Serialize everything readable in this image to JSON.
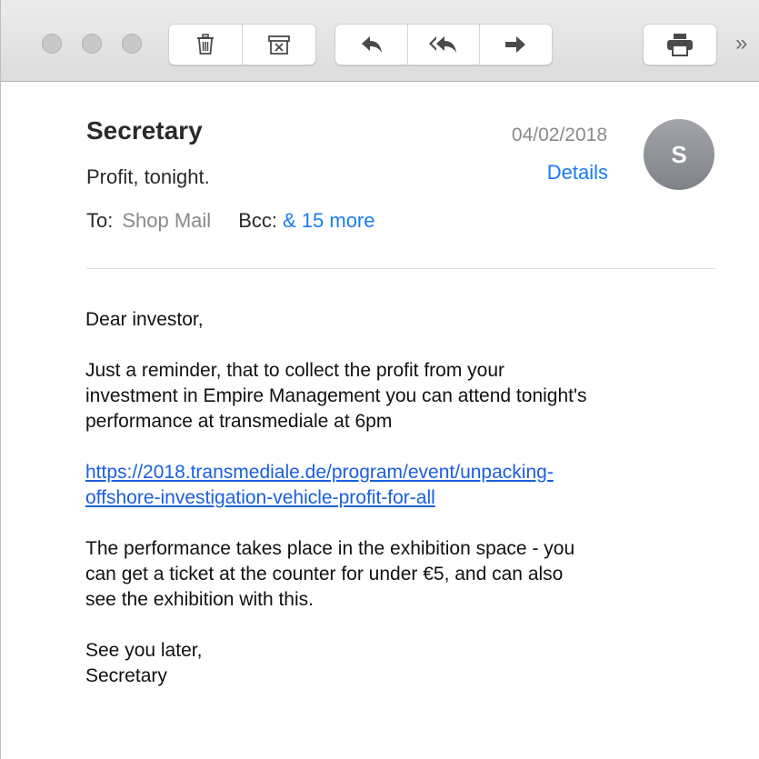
{
  "toolbar": {
    "window_controls": [
      "close",
      "minimize",
      "maximize"
    ],
    "buttons": [
      {
        "name": "delete",
        "icon": "trash-icon"
      },
      {
        "name": "junk",
        "icon": "junk-box-icon"
      },
      {
        "name": "reply",
        "icon": "reply-arrow-icon"
      },
      {
        "name": "reply-all",
        "icon": "reply-all-arrow-icon"
      },
      {
        "name": "forward",
        "icon": "forward-arrow-icon"
      },
      {
        "name": "print",
        "icon": "printer-icon"
      }
    ],
    "overflow_label": "»"
  },
  "header": {
    "sender": "Secretary",
    "subject": "Profit, tonight.",
    "date": "04/02/2018",
    "details_link": "Details",
    "avatar_initial": "S",
    "to_label": "To:",
    "to_value": "Shop Mail",
    "bcc_label": "Bcc:",
    "bcc_value": "& 15 more"
  },
  "message": {
    "greeting": "Dear investor,",
    "paragraph1_lines": [
      "Just a reminder, that to collect the profit from your",
      "investment in Empire Management you can attend tonight's",
      "performance at transmediale at 6pm"
    ],
    "link_lines": [
      "https://2018.transmediale.de/program/event/unpacking-",
      "offshore-investigation-vehicle-profit-for-all"
    ],
    "paragraph2_lines": [
      "The performance takes place in the exhibition space - you",
      "can get a ticket at the counter for under €5, and can also",
      "see the exhibition with this."
    ],
    "closing": "See you later,",
    "signature": "Secretary"
  },
  "colors": {
    "link": "#1a5fe0",
    "accent": "#1a7cf2",
    "avatar": "#8e9096",
    "toolbar": "#e3e3e3"
  }
}
